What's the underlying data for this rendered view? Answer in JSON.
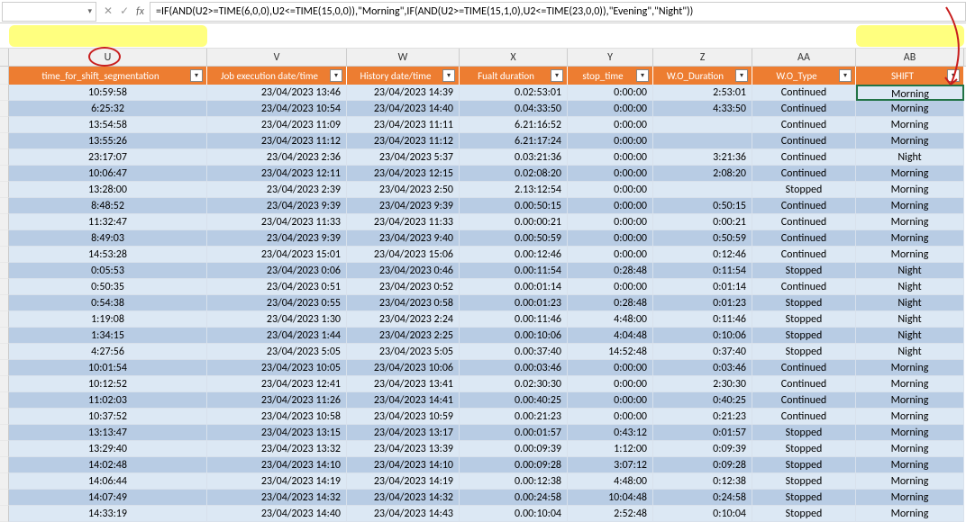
{
  "formula_bar": {
    "name_box_value": "",
    "cancel": "✕",
    "confirm": "✓",
    "fx": "fx",
    "formula": "=IF(AND(U2>=TIME(6,0,0),U2<=TIME(15,0,0)),\"Morning\",IF(AND(U2>=TIME(15,1,0),U2<=TIME(23,0,0)),\"Evening\",\"Night\"))"
  },
  "col_letters": [
    "U",
    "V",
    "W",
    "X",
    "Y",
    "Z",
    "AA",
    "AB"
  ],
  "headers": {
    "u": "time_for_shift_segmentation",
    "v": "Job execution date/time",
    "w": "History date/time",
    "x": "Fualt duration",
    "y": "stop_time",
    "z": "W.O_Duration",
    "aa": "W.O_Type",
    "ab": "SHIFT"
  },
  "rows": [
    {
      "u": "10:59:58",
      "v": "23/04/2023 13:46",
      "w": "23/04/2023 14:39",
      "x": "0.02:53:01",
      "y": "0:00:00",
      "z": "2:53:01",
      "aa": "Continued",
      "ab": "Morning"
    },
    {
      "u": "6:25:32",
      "v": "23/04/2023 10:54",
      "w": "23/04/2023 14:40",
      "x": "0.04:33:50",
      "y": "0:00:00",
      "z": "4:33:50",
      "aa": "Continued",
      "ab": "Morning"
    },
    {
      "u": "13:54:58",
      "v": "23/04/2023 11:09",
      "w": "23/04/2023 11:11",
      "x": "6.21:16:52",
      "y": "0:00:00",
      "z": "",
      "aa": "Continued",
      "ab": "Morning"
    },
    {
      "u": "13:55:26",
      "v": "23/04/2023 11:12",
      "w": "23/04/2023 11:12",
      "x": "6.21:17:24",
      "y": "0:00:00",
      "z": "",
      "aa": "Continued",
      "ab": "Morning"
    },
    {
      "u": "23:17:07",
      "v": "23/04/2023 2:36",
      "w": "23/04/2023 5:37",
      "x": "0.03:21:36",
      "y": "0:00:00",
      "z": "3:21:36",
      "aa": "Continued",
      "ab": "Night"
    },
    {
      "u": "10:06:47",
      "v": "23/04/2023 12:11",
      "w": "23/04/2023 12:15",
      "x": "0.02:08:20",
      "y": "0:00:00",
      "z": "2:08:20",
      "aa": "Continued",
      "ab": "Morning"
    },
    {
      "u": "13:28:00",
      "v": "23/04/2023 2:39",
      "w": "23/04/2023 2:50",
      "x": "2.13:12:54",
      "y": "0:00:00",
      "z": "",
      "aa": "Stopped",
      "ab": "Morning"
    },
    {
      "u": "8:48:52",
      "v": "23/04/2023 9:39",
      "w": "23/04/2023 9:39",
      "x": "0.00:50:15",
      "y": "0:00:00",
      "z": "0:50:15",
      "aa": "Continued",
      "ab": "Morning"
    },
    {
      "u": "11:32:47",
      "v": "23/04/2023 11:33",
      "w": "23/04/2023 11:33",
      "x": "0.00:00:21",
      "y": "0:00:00",
      "z": "0:00:21",
      "aa": "Continued",
      "ab": "Morning"
    },
    {
      "u": "8:49:03",
      "v": "23/04/2023 9:39",
      "w": "23/04/2023 9:40",
      "x": "0.00:50:59",
      "y": "0:00:00",
      "z": "0:50:59",
      "aa": "Continued",
      "ab": "Morning"
    },
    {
      "u": "14:53:28",
      "v": "23/04/2023 15:01",
      "w": "23/04/2023 15:06",
      "x": "0.00:12:46",
      "y": "0:00:00",
      "z": "0:12:46",
      "aa": "Continued",
      "ab": "Morning"
    },
    {
      "u": "0:05:53",
      "v": "23/04/2023 0:06",
      "w": "23/04/2023 0:46",
      "x": "0.00:11:54",
      "y": "0:28:48",
      "z": "0:11:54",
      "aa": "Stopped",
      "ab": "Night"
    },
    {
      "u": "0:50:35",
      "v": "23/04/2023 0:51",
      "w": "23/04/2023 0:52",
      "x": "0.00:01:14",
      "y": "0:00:00",
      "z": "0:01:14",
      "aa": "Continued",
      "ab": "Night"
    },
    {
      "u": "0:54:38",
      "v": "23/04/2023 0:55",
      "w": "23/04/2023 0:58",
      "x": "0.00:01:23",
      "y": "0:28:48",
      "z": "0:01:23",
      "aa": "Stopped",
      "ab": "Night"
    },
    {
      "u": "1:19:08",
      "v": "23/04/2023 1:30",
      "w": "23/04/2023 2:24",
      "x": "0.00:11:46",
      "y": "4:48:00",
      "z": "0:11:46",
      "aa": "Stopped",
      "ab": "Night"
    },
    {
      "u": "1:34:15",
      "v": "23/04/2023 1:44",
      "w": "23/04/2023 2:25",
      "x": "0.00:10:06",
      "y": "4:04:48",
      "z": "0:10:06",
      "aa": "Stopped",
      "ab": "Night"
    },
    {
      "u": "4:27:56",
      "v": "23/04/2023 5:05",
      "w": "23/04/2023 5:05",
      "x": "0.00:37:40",
      "y": "14:52:48",
      "z": "0:37:40",
      "aa": "Stopped",
      "ab": "Night"
    },
    {
      "u": "10:01:54",
      "v": "23/04/2023 10:05",
      "w": "23/04/2023 10:06",
      "x": "0.00:03:46",
      "y": "0:00:00",
      "z": "0:03:46",
      "aa": "Continued",
      "ab": "Morning"
    },
    {
      "u": "10:12:52",
      "v": "23/04/2023 12:41",
      "w": "23/04/2023 13:41",
      "x": "0.02:30:30",
      "y": "0:00:00",
      "z": "2:30:30",
      "aa": "Continued",
      "ab": "Morning"
    },
    {
      "u": "11:02:03",
      "v": "23/04/2023 11:26",
      "w": "23/04/2023 14:41",
      "x": "0.00:40:25",
      "y": "0:00:00",
      "z": "0:40:25",
      "aa": "Continued",
      "ab": "Morning"
    },
    {
      "u": "10:37:52",
      "v": "23/04/2023 10:58",
      "w": "23/04/2023 10:59",
      "x": "0.00:21:23",
      "y": "0:00:00",
      "z": "0:21:23",
      "aa": "Continued",
      "ab": "Morning"
    },
    {
      "u": "13:13:47",
      "v": "23/04/2023 13:15",
      "w": "23/04/2023 13:17",
      "x": "0.00:01:57",
      "y": "0:43:12",
      "z": "0:01:57",
      "aa": "Stopped",
      "ab": "Morning"
    },
    {
      "u": "13:29:40",
      "v": "23/04/2023 13:32",
      "w": "23/04/2023 13:39",
      "x": "0.00:09:39",
      "y": "1:12:00",
      "z": "0:09:39",
      "aa": "Stopped",
      "ab": "Morning"
    },
    {
      "u": "14:02:48",
      "v": "23/04/2023 14:10",
      "w": "23/04/2023 14:10",
      "x": "0.00:09:28",
      "y": "3:07:12",
      "z": "0:09:28",
      "aa": "Stopped",
      "ab": "Morning"
    },
    {
      "u": "14:06:44",
      "v": "23/04/2023 14:19",
      "w": "23/04/2023 14:19",
      "x": "0.00:12:38",
      "y": "4:48:00",
      "z": "0:12:38",
      "aa": "Stopped",
      "ab": "Morning"
    },
    {
      "u": "14:07:49",
      "v": "23/04/2023 14:32",
      "w": "23/04/2023 14:32",
      "x": "0.00:24:58",
      "y": "10:04:48",
      "z": "0:24:58",
      "aa": "Stopped",
      "ab": "Morning"
    },
    {
      "u": "14:33:19",
      "v": "23/04/2023 14:40",
      "w": "23/04/2023 14:43",
      "x": "0.00:10:04",
      "y": "2:52:48",
      "z": "0:10:04",
      "aa": "Stopped",
      "ab": "Morning"
    }
  ]
}
